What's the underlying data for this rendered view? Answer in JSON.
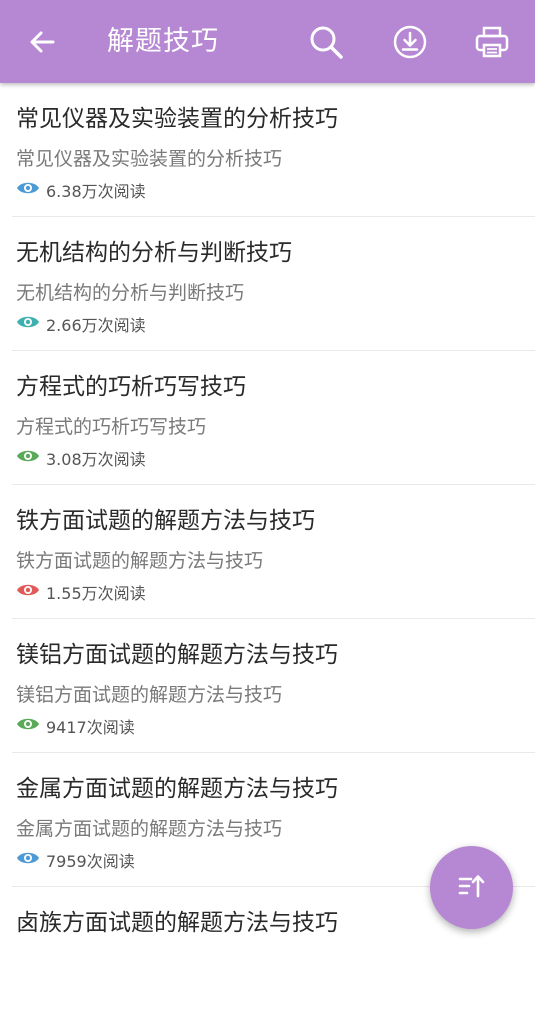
{
  "header": {
    "title": "解题技巧",
    "icons": [
      "back-arrow-icon",
      "search-icon",
      "download-icon",
      "print-icon"
    ]
  },
  "articles": [
    {
      "title": "常见仪器及实验装置的分析技巧",
      "subtitle": "常见仪器及实验装置的分析技巧",
      "reads": "6.38万次阅读",
      "eye_color": "#4d9bd6"
    },
    {
      "title": "无机结构的分析与判断技巧",
      "subtitle": "无机结构的分析与判断技巧",
      "reads": "2.66万次阅读",
      "eye_color": "#3fb0b0"
    },
    {
      "title": "方程式的巧析巧写技巧",
      "subtitle": "方程式的巧析巧写技巧",
      "reads": "3.08万次阅读",
      "eye_color": "#5aaa5a"
    },
    {
      "title": "铁方面试题的解题方法与技巧",
      "subtitle": "铁方面试题的解题方法与技巧",
      "reads": "1.55万次阅读",
      "eye_color": "#e05a5a"
    },
    {
      "title": "镁铝方面试题的解题方法与技巧",
      "subtitle": "镁铝方面试题的解题方法与技巧",
      "reads": "9417次阅读",
      "eye_color": "#5aaa5a"
    },
    {
      "title": "金属方面试题的解题方法与技巧",
      "subtitle": "金属方面试题的解题方法与技巧",
      "reads": "7959次阅读",
      "eye_color": "#4d9bd6"
    },
    {
      "title": "卤族方面试题的解题方法与技巧",
      "subtitle": "",
      "reads": "",
      "eye_color": "#4d9bd6"
    }
  ],
  "fab": {
    "icon": "sort-ascending-icon",
    "color": "#b687d3"
  },
  "colors": {
    "accent": "#b687d3"
  }
}
